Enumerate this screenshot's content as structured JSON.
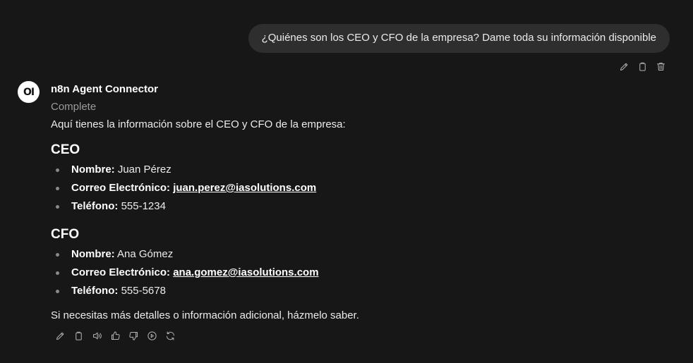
{
  "user_message": "¿Quiénes son los CEO y CFO de la empresa? Dame toda su información disponible",
  "assistant": {
    "avatar_text": "OI",
    "name": "n8n Agent Connector",
    "status": "Complete",
    "intro": "Aquí tienes la información sobre el CEO y CFO de la empresa:",
    "sections": [
      {
        "heading": "CEO",
        "name_label": "Nombre:",
        "name_value": "Juan Pérez",
        "email_label": "Correo Electrónico:",
        "email_value": "juan.perez@iasolutions.com",
        "phone_label": "Teléfono:",
        "phone_value": "555-1234"
      },
      {
        "heading": "CFO",
        "name_label": "Nombre:",
        "name_value": "Ana Gómez",
        "email_label": "Correo Electrónico:",
        "email_value": "ana.gomez@iasolutions.com",
        "phone_label": "Teléfono:",
        "phone_value": "555-5678"
      }
    ],
    "closing": "Si necesitas más detalles o información adicional, házmelo saber."
  },
  "icons": {
    "user_actions": [
      "pencil-icon",
      "copy-icon",
      "trash-icon"
    ],
    "assistant_actions": [
      "pencil-icon",
      "copy-icon",
      "speaker-icon",
      "thumbs-up-icon",
      "thumbs-down-icon",
      "play-circle-icon",
      "regenerate-icon"
    ]
  },
  "colors": {
    "background": "#171717",
    "bubble": "#2e2e2e",
    "muted": "#9b9b9b"
  }
}
